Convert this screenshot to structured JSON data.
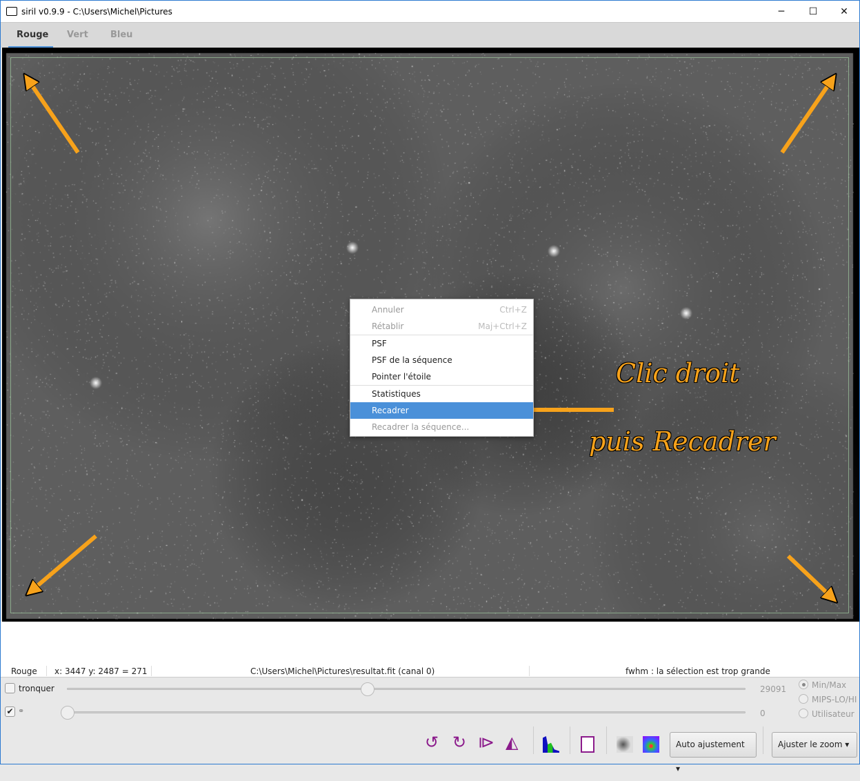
{
  "window": {
    "title": "siril v0.9.9 - C:\\Users\\Michel\\Pictures",
    "minimize": "─",
    "maximize": "☐",
    "close": "✕"
  },
  "tabs": [
    {
      "label": "Rouge",
      "active": true
    },
    {
      "label": "Vert"
    },
    {
      "label": "Bleu"
    }
  ],
  "context_menu": {
    "items": [
      {
        "label": "Annuler",
        "shortcut": "Ctrl+Z",
        "disabled": true
      },
      {
        "label": "Rétablir",
        "shortcut": "Maj+Ctrl+Z",
        "disabled": true
      },
      {
        "label": "PSF"
      },
      {
        "label": "PSF de la séquence"
      },
      {
        "label": "Pointer l'étoile"
      },
      {
        "label": "Statistiques"
      },
      {
        "label": "Recadrer",
        "highlighted": true
      },
      {
        "label": "Recadrer la séquence...",
        "disabled": true
      }
    ]
  },
  "annotations": {
    "line1": "Clic droit",
    "line2": "puis Recadrer",
    "color": "#f7a21b"
  },
  "status": {
    "channel": "Rouge",
    "coords": "x: 3447 y: 2487 = 271",
    "file": "C:\\Users\\Michel\\Pictures\\resultat.fit (canal 0)",
    "fwhm": "fwhm : la sélection est trop grande"
  },
  "controls": {
    "clip_label": "tronquer",
    "clip_checked": false,
    "link_checked": true,
    "high_value": "29091",
    "low_value": "0",
    "high_slider_fraction": 0.44,
    "low_slider_fraction": 0.0,
    "modes": [
      {
        "label": "Min/Max",
        "selected": true
      },
      {
        "label": "MIPS-LO/HI"
      },
      {
        "label": "Utilisateur"
      }
    ],
    "auto_button": "Auto ajustement ▾",
    "zoom_button": "Ajuster le zoom ▾"
  },
  "toolbar_icons": {
    "rotate_left": "↺",
    "rotate_right": "↻",
    "mirror_x": "⧐",
    "mirror_y": "◭"
  }
}
